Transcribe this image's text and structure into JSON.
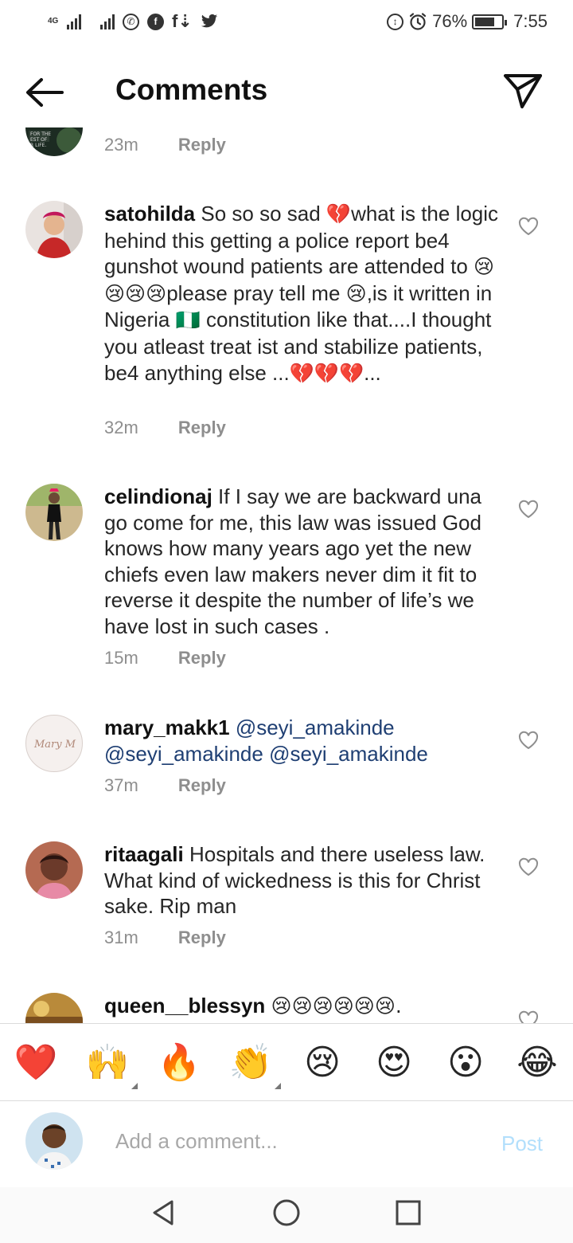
{
  "status_bar": {
    "network_tag": "4G",
    "battery": "76%",
    "battery_level": 0.76,
    "time": "7:55",
    "icons": [
      "signal-icon",
      "signal-icon",
      "whatsapp-icon",
      "facebook-icon",
      "facebook-download-icon",
      "twitter-icon",
      "data-saver-icon",
      "alarm-icon",
      "battery-icon"
    ]
  },
  "header": {
    "title": "Comments"
  },
  "comments": [
    {
      "username": "",
      "text": "",
      "time": "23m",
      "reply": "Reply"
    },
    {
      "username": "satohilda",
      "parts": [
        "So so so sad ",
        "💔",
        "what is the logic hehind this getting a police report be4 gunshot wound patients are attended to ",
        "😢😢😢😢",
        "please pray tell me ",
        "😢",
        ",is it written in Nigeria ",
        "🇳🇬",
        " constitution like that....I thought you atleast treat ist and stabilize patients, be4 anything else ...",
        "💔💔💔",
        "..."
      ],
      "time": "32m",
      "reply": "Reply"
    },
    {
      "username": "celindionaj",
      "text": "If I say we are backward una go come for me, this law was issued God knows how many years ago yet the new chiefs even law makers never dim it fit to reverse it despite the number of life’s we have lost in such cases .",
      "time": "15m",
      "reply": "Reply"
    },
    {
      "username": "mary_makk1",
      "mentions": [
        "@seyi_amakinde",
        "@seyi_amakinde",
        "@seyi_amakinde"
      ],
      "avatar_text": "Mary M",
      "time": "37m",
      "reply": "Reply"
    },
    {
      "username": "ritaagali",
      "text": "Hospitals and there useless law. What kind of wickedness is this for Christ sake. Rip man",
      "time": "31m",
      "reply": "Reply"
    },
    {
      "username": "queen__blessyn",
      "text": "😢😢😢😢😢😢."
    }
  ],
  "emoji_bar": [
    "❤️",
    "🙌",
    "🔥",
    "👏",
    "😢",
    "😍",
    "😮",
    "😂"
  ],
  "composer": {
    "placeholder": "Add a comment...",
    "post_label": "Post"
  },
  "colors": {
    "accent": "#0095f6",
    "post_disabled": "#b2dffc",
    "muted": "#8e8e8e",
    "mention": "#1f3f73"
  }
}
